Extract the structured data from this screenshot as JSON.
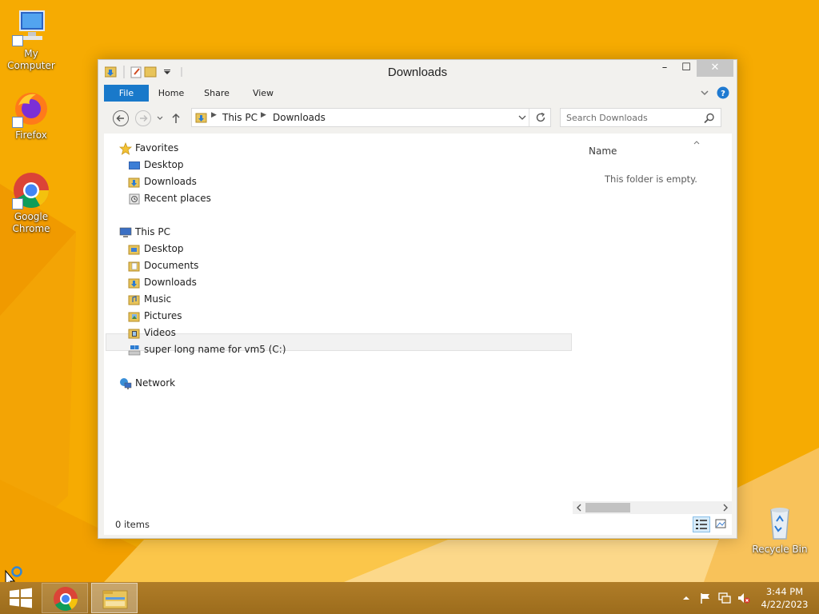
{
  "desktop": {
    "icons": [
      {
        "label": "My Computer"
      },
      {
        "label": "Firefox"
      },
      {
        "label": "Google Chrome"
      },
      {
        "label": "Recycle Bin"
      }
    ]
  },
  "window": {
    "title": "Downloads",
    "controls": {
      "minimize": "–",
      "maximize": "☐",
      "close": "✕"
    },
    "ribbon": {
      "tabs": [
        "File",
        "Home",
        "Share",
        "View"
      ]
    },
    "address": {
      "crumbs": [
        "This PC",
        "Downloads"
      ]
    },
    "search": {
      "placeholder": "Search Downloads"
    },
    "nav": {
      "favorites": {
        "label": "Favorites",
        "items": [
          "Desktop",
          "Downloads",
          "Recent places"
        ]
      },
      "this_pc": {
        "label": "This PC",
        "items": [
          "Desktop",
          "Documents",
          "Downloads",
          "Music",
          "Pictures",
          "Videos",
          "super long name for vm5 (C:)"
        ]
      },
      "network": {
        "label": "Network"
      }
    },
    "file_list": {
      "column_name": "Name",
      "empty_message": "This folder is empty."
    },
    "status": {
      "item_count": "0 items"
    }
  },
  "taskbar": {
    "clock_time": "3:44 PM",
    "clock_date": "4/22/2023"
  },
  "colors": {
    "desktop": "#f5a800",
    "accent": "#1979ca",
    "taskbar": "#a87525"
  }
}
